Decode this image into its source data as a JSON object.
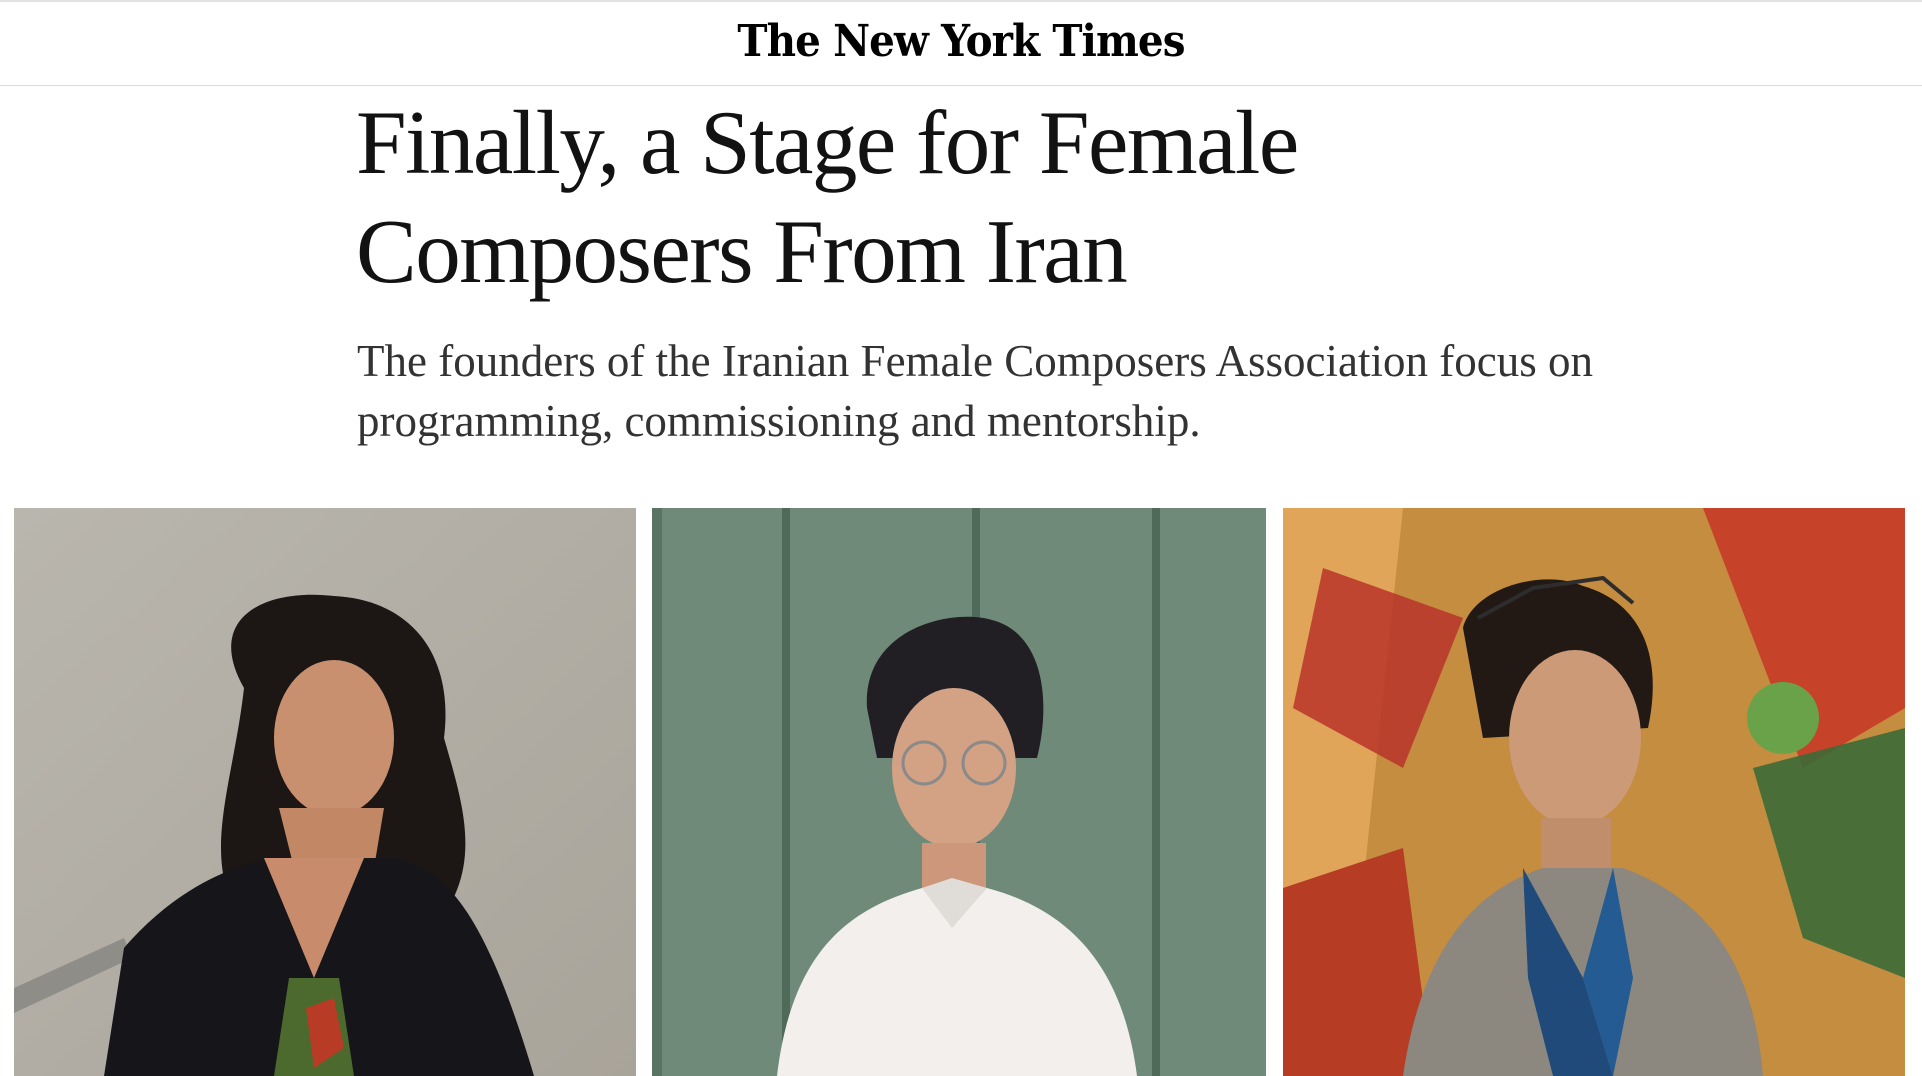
{
  "masthead": {
    "logo_text": "The New York Times"
  },
  "article": {
    "headline": "Finally, a Stage for Female Composers From Iran",
    "summary": "The founders of the Iranian Female Composers Association focus on programming, commissioning and mentorship."
  },
  "photos": [
    {
      "subject": "woman-curly-hair-black-cardigan"
    },
    {
      "subject": "woman-short-hair-glasses-white-shirt"
    },
    {
      "subject": "woman-sunglasses-gray-blazer-graffiti-wall"
    }
  ],
  "colors": {
    "ink": "#121212",
    "rule": "#dcdcdc",
    "background": "#ffffff"
  }
}
